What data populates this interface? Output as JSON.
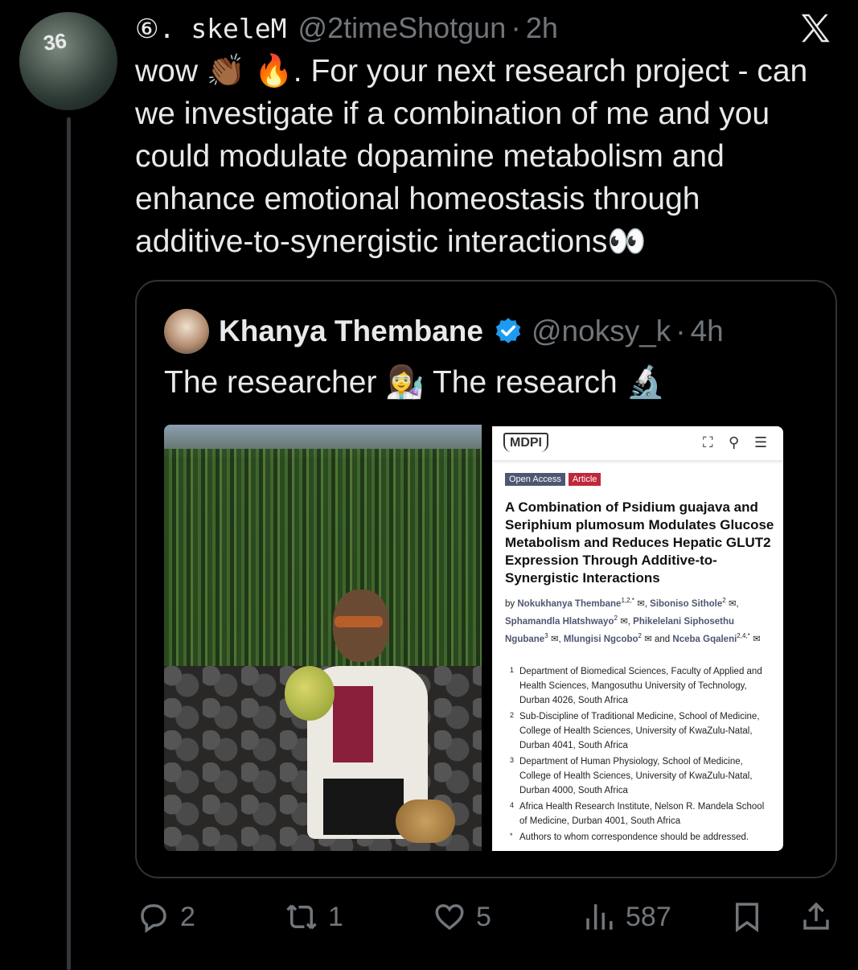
{
  "tweet": {
    "author_name": "⑥. skeleM",
    "handle": "@2timeShotgun",
    "separator": "·",
    "time": "2h",
    "avatar_number": "36",
    "text_lines": [
      "wow 👏🏾 🔥. For your next research project - can",
      "we investigate if a combination of me and you",
      "could modulate dopamine metabolism and",
      "enhance emotional homeostasis through",
      "additive-to-synergistic interactions👀"
    ]
  },
  "quote": {
    "author_name": "Khanya Thembane",
    "handle": "@noksy_k",
    "separator": "·",
    "time": "4h",
    "text": "The researcher  👩‍🔬  The research 🔬",
    "verified_color": "#1d9bf0"
  },
  "paper": {
    "publisher": "MDPI",
    "tag_open_access": "Open Access",
    "tag_article": "Article",
    "title": "A Combination of Psidium guajava and Seriphium plumosum Modulates Glucose Metabolism and Reduces Hepatic GLUT2 Expression Through Additive-to-Synergistic Interactions",
    "by": "by",
    "authors": [
      {
        "name": "Nokukhanya Thembane",
        "sup": "1,2,*"
      },
      {
        "name": "Siboniso Sithole",
        "sup": "2"
      },
      {
        "name": "Sphamandla Hlatshwayo",
        "sup": "2"
      },
      {
        "name": "Phikelelani Siphosethu Ngubane",
        "sup": "3"
      },
      {
        "name": "Mlungisi Ngcobo",
        "sup": "2"
      },
      {
        "name": "Nceba Gqaleni",
        "sup": "2,4,*"
      }
    ],
    "and_word": "and",
    "affiliations": [
      {
        "num": "1",
        "text": "Department of Biomedical Sciences, Faculty of Applied and Health Sciences, Mangosuthu University of Technology, Durban 4026, South Africa"
      },
      {
        "num": "2",
        "text": "Sub-Discipline of Traditional Medicine, School of Medicine, College of Health Sciences, University of KwaZulu-Natal, Durban 4041, South Africa"
      },
      {
        "num": "3",
        "text": "Department of Human Physiology, School of Medicine, College of Health Sciences, University of KwaZulu-Natal, Durban 4000, South Africa"
      },
      {
        "num": "4",
        "text": "Africa Health Research Institute, Nelson R. Mandela School of Medicine, Durban 4001, South Africa"
      },
      {
        "num": "*",
        "text": "Authors to whom correspondence should be addressed."
      }
    ]
  },
  "actions": {
    "replies": "2",
    "reposts": "1",
    "likes": "5",
    "views": "587"
  }
}
